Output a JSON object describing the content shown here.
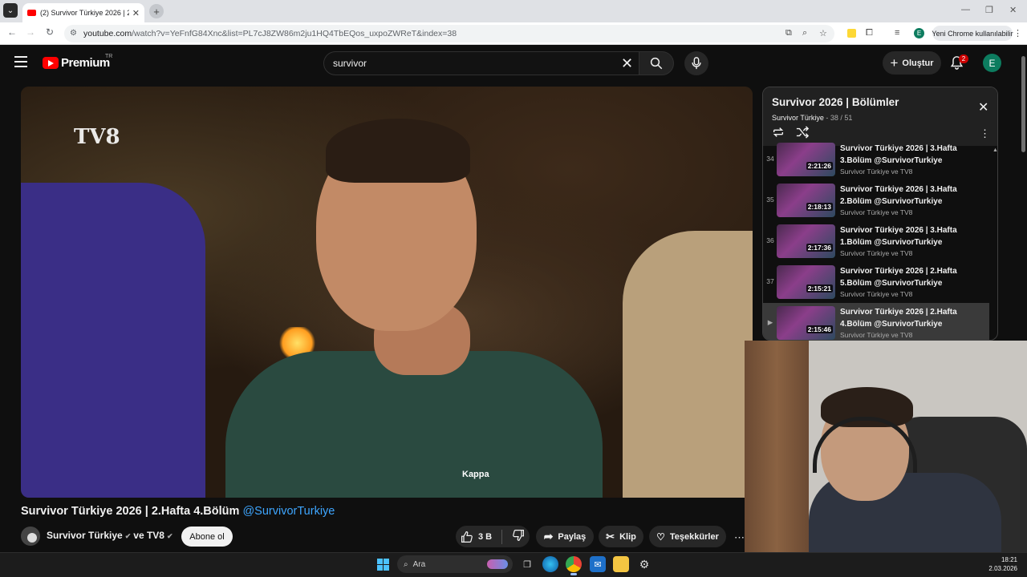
{
  "browser": {
    "tab_title": "(2) Survivor Türkiye 2026 | 2.Haft",
    "tab_close": "✕",
    "new_tab": "+",
    "url_host": "youtube.com",
    "url_rest": "/watch?v=YeFnfG84Xnc&list=PL7cJ8ZW86m2ju1HQ4TbEQos_uxpoZWReT&index=38",
    "update_label": "Yeni Chrome kullanılabilir",
    "profile_initial": "E"
  },
  "youtube": {
    "logo_text": "Premium",
    "region": "TR",
    "search_value": "survivor",
    "create_label": "Oluştur",
    "notification_count": "2",
    "avatar_initial": "E"
  },
  "video": {
    "overlay_logo": "TV8",
    "shirt_brand": "Kappa",
    "title": "Survivor Türkiye 2026 | 2.Hafta 4.Bölüm",
    "title_handle": "@SurvivorTurkiye",
    "channel_name": "Survivor Türkiye",
    "channel_joiner": "ve TV8",
    "subscribe_label": "Abone ol",
    "like_count": "3 B",
    "share_label": "Paylaş",
    "clip_label": "Klip",
    "thanks_label": "Teşekkürler"
  },
  "playlist": {
    "title": "Survivor 2026 | Bölümler",
    "owner": "Survivor Türkiye",
    "position": "38 / 51",
    "items": [
      {
        "index": "34",
        "title": "Survivor Türkiye 2026 | 3.Hafta 3.Bölüm @SurvivorTurkiye",
        "duration": "2:21:26",
        "channel": "Survivor Türkiye ve TV8"
      },
      {
        "index": "35",
        "title": "Survivor Türkiye 2026 | 3.Hafta 2.Bölüm @SurvivorTurkiye",
        "duration": "2:18:13",
        "channel": "Survivor Türkiye ve TV8"
      },
      {
        "index": "36",
        "title": "Survivor Türkiye 2026 | 3.Hafta 1.Bölüm @SurvivorTurkiye",
        "duration": "2:17:36",
        "channel": "Survivor Türkiye ve TV8"
      },
      {
        "index": "37",
        "title": "Survivor Türkiye 2026 | 2.Hafta 5.Bölüm @SurvivorTurkiye",
        "duration": "2:15:21",
        "channel": "Survivor Türkiye ve TV8"
      },
      {
        "index": "▶",
        "title": "Survivor Türkiye 2026 | 2.Hafta 4.Bölüm @SurvivorTurkiye",
        "duration": "2:15:46",
        "channel": "Survivor Türkiye ve TV8"
      }
    ]
  },
  "taskbar": {
    "search_label": "Ara",
    "time": "18:21",
    "date": "2.03.2026"
  }
}
